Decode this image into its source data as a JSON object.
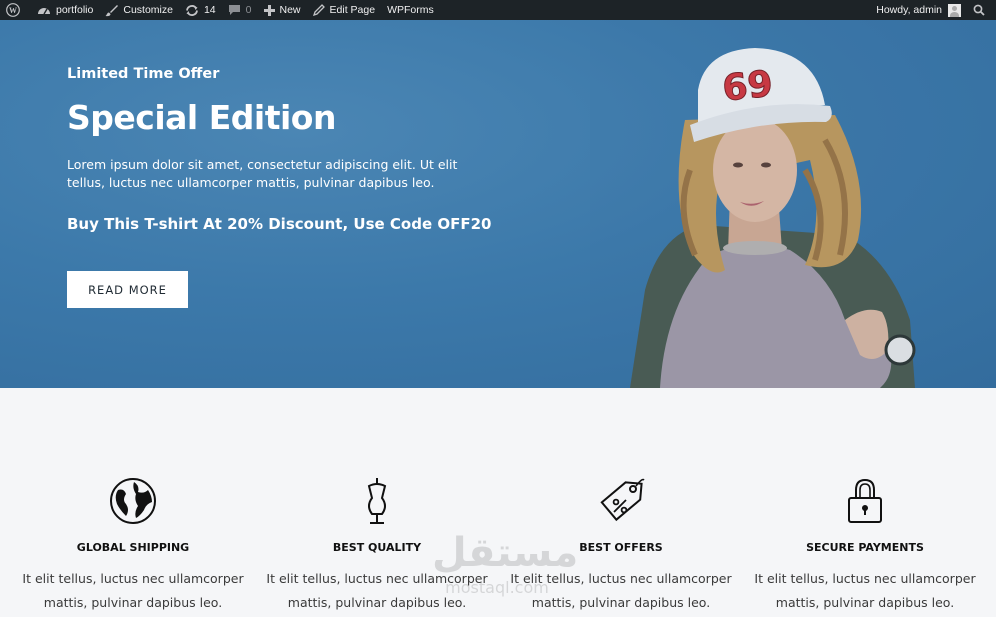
{
  "adminbar": {
    "site_name": "portfolio",
    "customize": "Customize",
    "updates_count": "14",
    "comments_count": "0",
    "new_label": "New",
    "edit_page": "Edit Page",
    "wpforms": "WPForms",
    "greeting": "Howdy, admin"
  },
  "hero": {
    "eyebrow": "Limited Time Offer",
    "title": "Special Edition",
    "description": "Lorem ipsum dolor sit amet, consectetur adipiscing elit. Ut elit tellus, luctus nec ullamcorper mattis, pulvinar dapibus leo.",
    "promo": "Buy This T-shirt At 20% Discount, Use Code OFF20",
    "button_label": "READ MORE",
    "cap_number": "69"
  },
  "features": [
    {
      "icon": "globe-icon",
      "title": "GLOBAL SHIPPING",
      "text": "It elit tellus, luctus nec ullamcorper mattis, pulvinar dapibus leo."
    },
    {
      "icon": "mannequin-icon",
      "title": "BEST QUALITY",
      "text": "It elit tellus, luctus nec ullamcorper mattis, pulvinar dapibus leo."
    },
    {
      "icon": "price-tag-icon",
      "title": "BEST OFFERS",
      "text": "It elit tellus, luctus nec ullamcorper mattis, pulvinar dapibus leo."
    },
    {
      "icon": "padlock-icon",
      "title": "SECURE PAYMENTS",
      "text": "It elit tellus, luctus nec ullamcorper mattis, pulvinar dapibus leo."
    }
  ],
  "watermark": {
    "arabic": "مستقل",
    "latin": "mostaql.com"
  },
  "colors": {
    "hero_blue": "#3c79aa",
    "adminbar": "#1d2327",
    "page_bg": "#f5f6f8"
  }
}
